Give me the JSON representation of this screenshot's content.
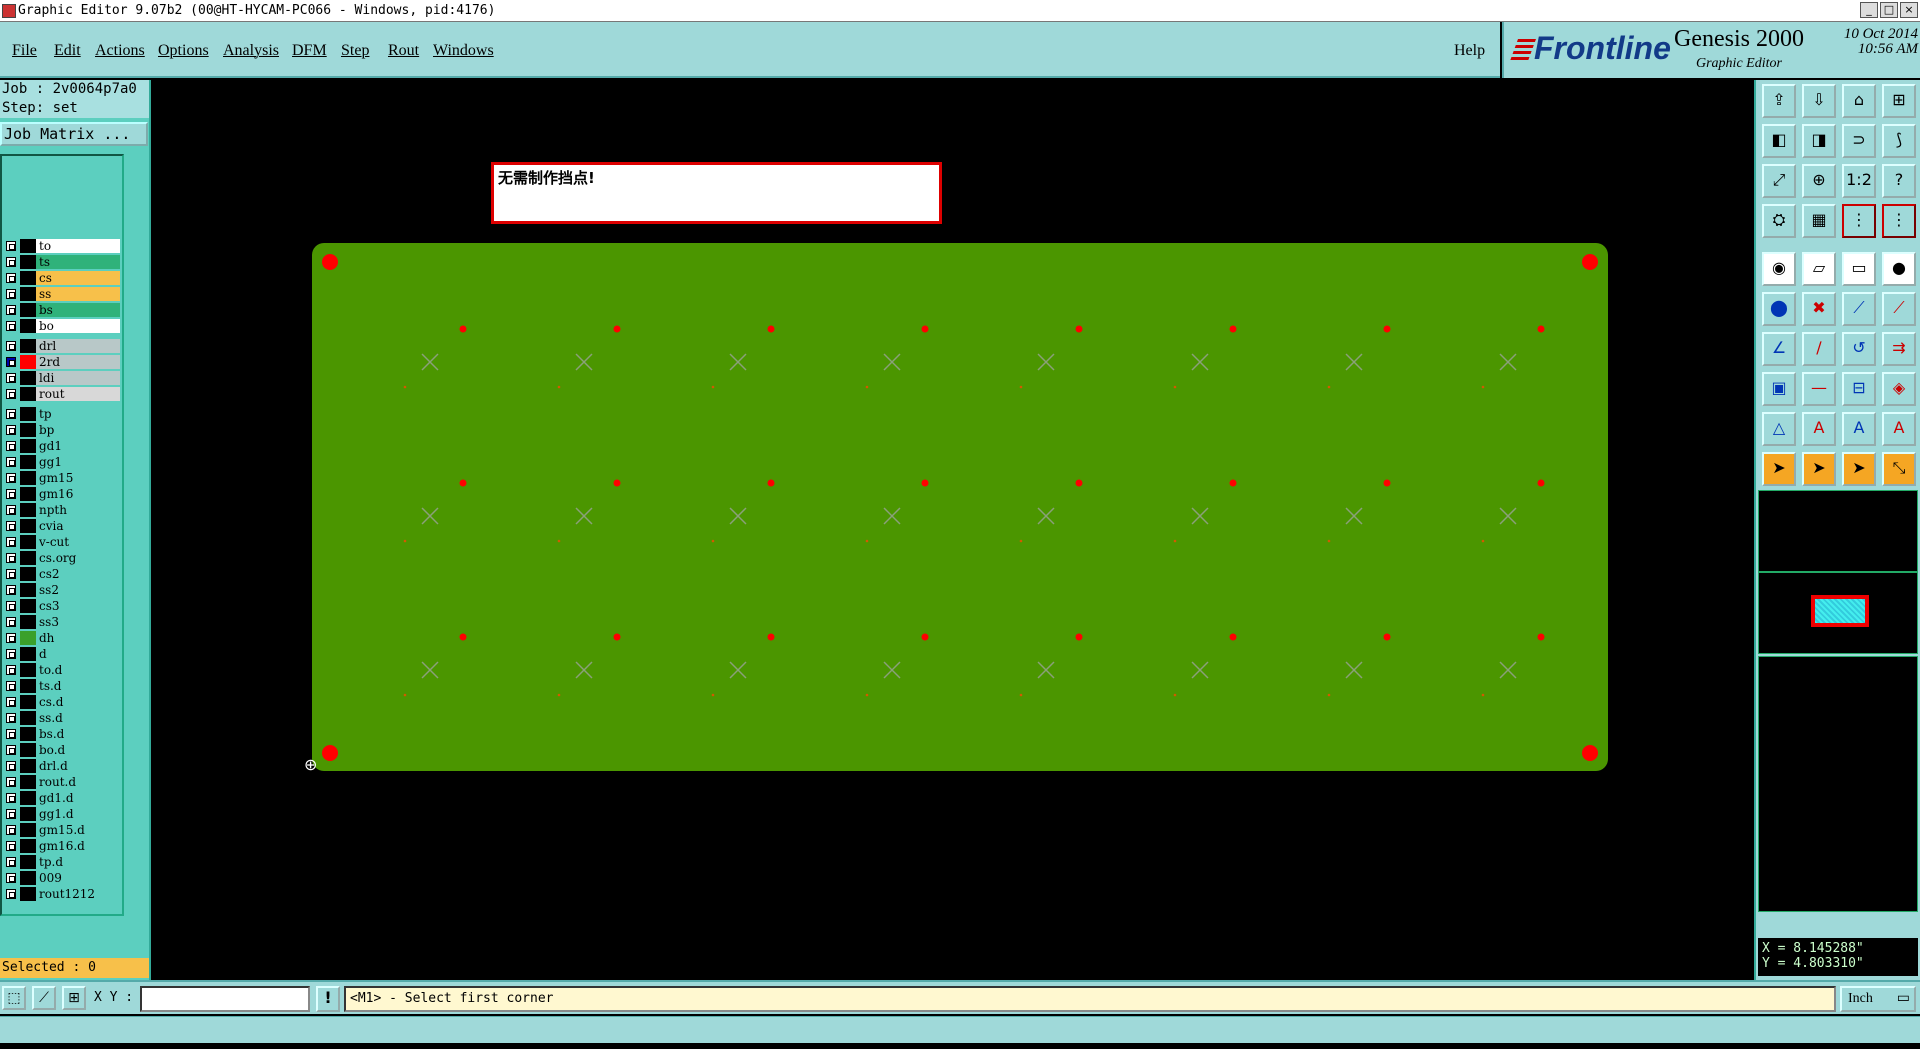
{
  "window": {
    "title": "Graphic Editor 9.07b2 (00@HT-HYCAM-PC066 - Windows, pid:4176)",
    "buttons": [
      "_",
      "□",
      "×"
    ]
  },
  "menu": {
    "items": [
      "File",
      "Edit",
      "Actions",
      "Options",
      "Analysis",
      "DFM",
      "Step",
      "Rout",
      "Windows"
    ],
    "help": "Help"
  },
  "brand": {
    "logo": "Frontline",
    "product": "Genesis 2000",
    "subtitle": "Graphic Editor",
    "date": "10 Oct 2014",
    "time": "10:56 AM"
  },
  "job": {
    "job_label": "Job : 2v0064p7a0",
    "step_label": "Step: set",
    "job_matrix_button": "Job Matrix ...",
    "selected_label": "Selected : 0"
  },
  "layers": {
    "group1": [
      {
        "name": "to",
        "color": "#ffffff"
      },
      {
        "name": "ts",
        "color": "#2fb27a"
      },
      {
        "name": "cs",
        "color": "#f7c04a"
      },
      {
        "name": "ss",
        "color": "#f7c04a"
      },
      {
        "name": "bs",
        "color": "#2fb27a"
      },
      {
        "name": "bo",
        "color": "#ffffff"
      }
    ],
    "group2": [
      {
        "name": "drl",
        "color": "#b8c8c8"
      },
      {
        "name": "2rd",
        "color": "#b8c8c8",
        "active": true,
        "swatch": "#ff0000"
      },
      {
        "name": "ldi",
        "color": "#b8c8c8"
      },
      {
        "name": "rout",
        "color": "#d8d8d8"
      }
    ],
    "group3": [
      {
        "name": "tp"
      },
      {
        "name": "bp"
      },
      {
        "name": "gd1"
      },
      {
        "name": "gg1"
      },
      {
        "name": "gm15"
      },
      {
        "name": "gm16"
      },
      {
        "name": "npth"
      },
      {
        "name": "cvia"
      },
      {
        "name": "v-cut"
      },
      {
        "name": "cs.org"
      },
      {
        "name": "cs2"
      },
      {
        "name": "ss2"
      },
      {
        "name": "cs3"
      },
      {
        "name": "ss3"
      },
      {
        "name": "dh",
        "swatch": "#3aa02a"
      },
      {
        "name": "d"
      },
      {
        "name": "to.d"
      },
      {
        "name": "ts.d"
      },
      {
        "name": "cs.d"
      },
      {
        "name": "ss.d"
      },
      {
        "name": "bs.d"
      },
      {
        "name": "bo.d"
      },
      {
        "name": "drl.d"
      },
      {
        "name": "rout.d"
      },
      {
        "name": "gd1.d"
      },
      {
        "name": "gg1.d"
      },
      {
        "name": "gm15.d"
      },
      {
        "name": "gm16.d"
      },
      {
        "name": "tp.d"
      },
      {
        "name": "009"
      },
      {
        "name": "rout1212"
      }
    ]
  },
  "message_box": {
    "text": "无需制作挡点!"
  },
  "board": {
    "fill_color": "#4b9600",
    "feature_color": "#ff0000",
    "mark_color": "#8aa07a"
  },
  "toolbar": {
    "icons": [
      "layer-up-icon",
      "layer-down-icon",
      "home-icon",
      "split-view-icon",
      "layer-left-icon",
      "layer-right-icon",
      "flip-icon",
      "snap-icon",
      "zoom-fit-icon",
      "zoom-home-icon",
      "zoom-1to1-icon",
      "help-icon",
      "measure-icon",
      "grid-icon",
      "net-icon",
      "net-red-icon",
      "select-box-icon",
      "select-poly-icon",
      "ruler-icon",
      "pad-icon",
      "connect-icon",
      "cross-icon",
      "line-point-icon",
      "line-point-blue-icon",
      "angle-icon",
      "slope-icon",
      "arc-icon",
      "mirror-icon",
      "pad-move-icon",
      "line-icon",
      "resize-icon",
      "group-icon",
      "triangle-icon",
      "text-a-icon",
      "text-a-outline-icon",
      "text-a-bar-icon",
      "pointer-icon",
      "pointer-box-icon",
      "pointer-circle-icon",
      "pointer-drag-icon"
    ]
  },
  "coords": {
    "x": "X = 8.145288\"",
    "y": "Y = 4.803310\""
  },
  "bottom": {
    "xy_label": "X Y :",
    "xy_value": "",
    "prompt": "<M1> - Select first corner",
    "units": "Inch"
  }
}
